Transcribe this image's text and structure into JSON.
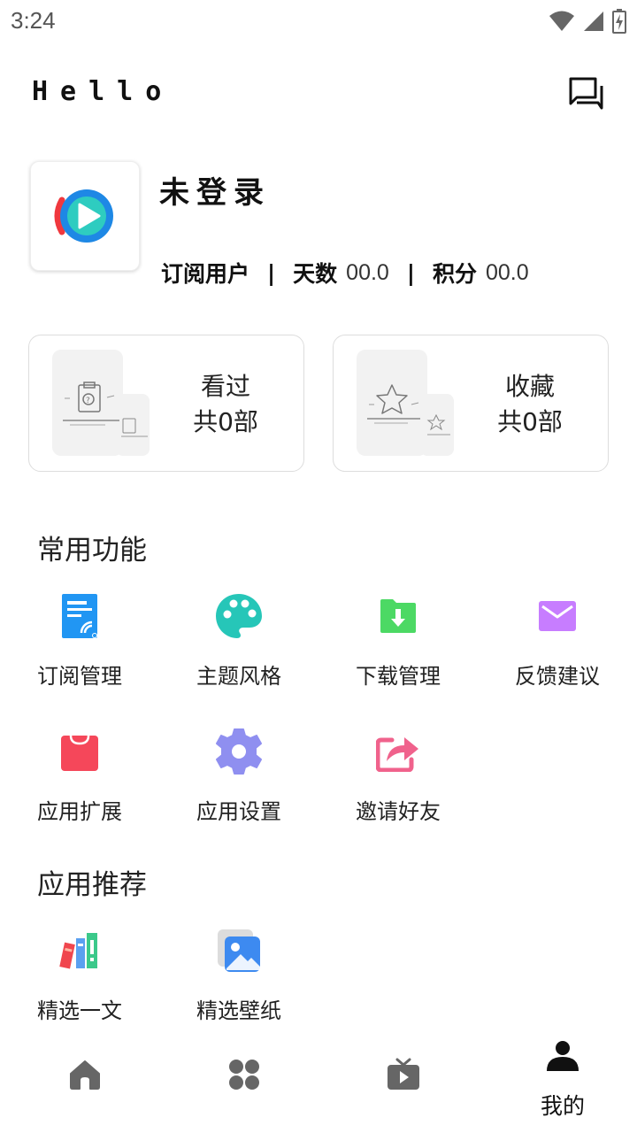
{
  "status_bar": {
    "time": "3:24"
  },
  "header": {
    "title": "Hello"
  },
  "profile": {
    "username": "未登录",
    "subscription_label": "订阅用户",
    "days_label": "天数",
    "days_value": "00.0",
    "points_label": "积分",
    "points_value": "00.0",
    "separator": "|"
  },
  "cards": {
    "history": {
      "title": "看过",
      "count": "共0部"
    },
    "favorites": {
      "title": "收藏",
      "count": "共0部"
    }
  },
  "common_functions": {
    "title": "常用功能",
    "items": [
      {
        "label": "订阅管理",
        "icon": "subscription-icon",
        "color": "#2196F3"
      },
      {
        "label": "主题风格",
        "icon": "palette-icon",
        "color": "#26C6B8"
      },
      {
        "label": "下载管理",
        "icon": "download-folder-icon",
        "color": "#4CD964"
      },
      {
        "label": "反馈建议",
        "icon": "mail-icon",
        "color": "#C77DFF"
      },
      {
        "label": "应用扩展",
        "icon": "shopping-bag-icon",
        "color": "#F5475A"
      },
      {
        "label": "应用设置",
        "icon": "settings-gear-icon",
        "color": "#8F8FF0"
      },
      {
        "label": "邀请好友",
        "icon": "share-icon",
        "color": "#F0628C"
      }
    ]
  },
  "recommended_apps": {
    "title": "应用推荐",
    "items": [
      {
        "label": "精选一文",
        "icon": "books-icon"
      },
      {
        "label": "精选壁纸",
        "icon": "wallpaper-icon"
      }
    ]
  },
  "bottom_nav": {
    "items": [
      {
        "icon": "home-icon",
        "active": false
      },
      {
        "icon": "apps-grid-icon",
        "active": false
      },
      {
        "icon": "tv-icon",
        "active": false
      },
      {
        "icon": "person-icon",
        "label": "我的",
        "active": true
      }
    ]
  },
  "colors": {
    "text": "#222222",
    "nav_inactive": "#666666",
    "card_border": "#DDDDDD"
  }
}
